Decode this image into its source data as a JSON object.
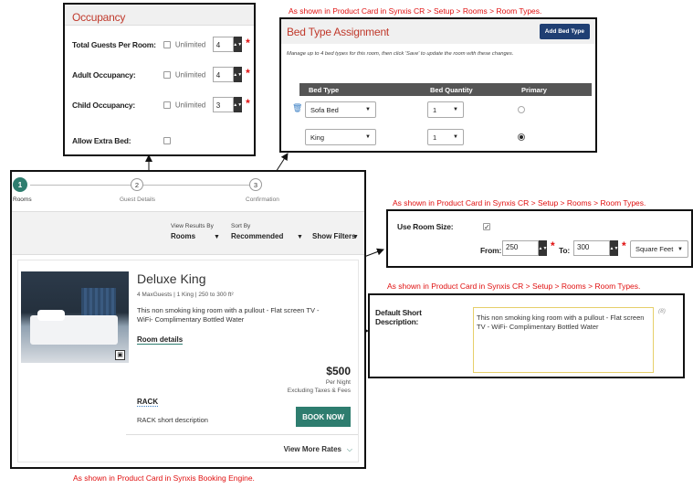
{
  "captions": {
    "bed_type": "As shown in Product Card in Synxis CR > Setup > Rooms > Room Types.",
    "room_size": "As shown in Product Card in Synxis CR > Setup > Rooms > Room Types.",
    "short_desc": "As shown in Product Card in Synxis CR > Setup > Rooms > Room Types.",
    "booking_engine": "As shown in Product Card in Synxis Booking Engine."
  },
  "occupancy": {
    "title": "Occupancy",
    "rows": [
      {
        "label": "Total Guests Per Room:",
        "check_label": "Unlimited",
        "value": "4"
      },
      {
        "label": "Adult Occupancy:",
        "check_label": "Unlimited",
        "value": "4"
      },
      {
        "label": "Child Occupancy:",
        "check_label": "Unlimited",
        "value": "3"
      }
    ],
    "extra_bed_label": "Allow Extra Bed:"
  },
  "bed_type": {
    "title": "Bed Type Assignment",
    "add_button": "Add Bed Type",
    "instructions": "Manage up to 4 bed types for this room, then click 'Save' to update the room with these changes.",
    "columns": [
      "Bed Type",
      "Bed Quantity",
      "Primary"
    ],
    "rows": [
      {
        "bed": "Sofa Bed",
        "qty": "1",
        "primary": false
      },
      {
        "bed": "King",
        "qty": "1",
        "primary": true
      }
    ]
  },
  "room_size": {
    "label": "Use Room Size:",
    "from_label": "From:",
    "from_value": "250",
    "to_label": "To:",
    "to_value": "300",
    "unit": "Square Feet"
  },
  "short_desc": {
    "label": "Default Short Description:",
    "text": "This non smoking king room with a pullout - Flat screen TV - WiFi- Complimentary Bottled Water",
    "counter": "(8)"
  },
  "booking": {
    "steps": [
      {
        "num": "1",
        "label": "Rooms"
      },
      {
        "num": "2",
        "label": "Guest Details"
      },
      {
        "num": "3",
        "label": "Confirmation"
      }
    ],
    "view_results_label": "View Results By",
    "view_results_value": "Rooms",
    "sort_label": "Sort By",
    "sort_value": "Recommended",
    "show_filters": "Show Filters",
    "room_name": "Deluxe King",
    "room_meta": "4 MaxGuests  |  1 King  |  250 to 300 ft²",
    "room_desc": "This non smoking king room with a pullout - Flat screen TV - WiFi- Complimentary Bottled Water",
    "room_details": "Room details",
    "price": "$500",
    "per_night": "Per Night",
    "excluding": "Excluding Taxes & Fees",
    "rate_name": "RACK",
    "rate_desc": "RACK short description",
    "book_now": "BOOK NOW",
    "view_more": "View More Rates"
  },
  "colors": {
    "accent_red": "#e01010",
    "occupancy_title": "#c0392b",
    "teal": "#2e7d6f",
    "bed_header": "#555555"
  }
}
